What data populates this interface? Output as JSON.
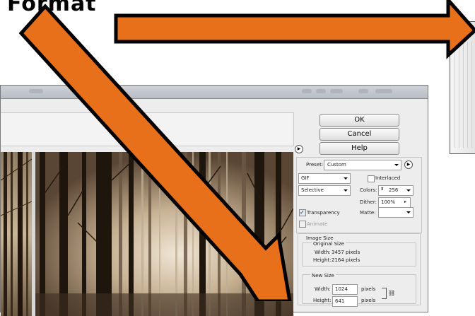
{
  "heading": {
    "text": "Format"
  },
  "colors": {
    "arrow_fill": "#e8701a",
    "arrow_stroke": "#000000"
  },
  "buttons": {
    "ok": "OK",
    "cancel": "Cancel",
    "help": "Help"
  },
  "settings": {
    "preset_label": "Preset:",
    "preset_value": "Custom",
    "format_value": "GIF",
    "interlaced_label": "Interlaced",
    "reduction_value": "Selective",
    "colors_label": "Colors:",
    "colors_value": "256",
    "dither_label": "Dither:",
    "dither_value": "100%",
    "transparency_label": "Transparency",
    "matte_label": "Matte:",
    "animate_label": "Animate"
  },
  "image_size": {
    "section_label": "Image Size",
    "original_label": "Original Size",
    "orig_width_label": "Width:",
    "orig_width_value": "3457 pixels",
    "orig_height_label": "Height:",
    "orig_height_value": "2164 pixels",
    "new_label": "New Size",
    "new_width_label": "Width:",
    "new_width_value": "1024",
    "new_width_unit": "pixels",
    "new_height_label": "Height:",
    "new_height_value": "641",
    "new_height_unit": "pixels"
  }
}
